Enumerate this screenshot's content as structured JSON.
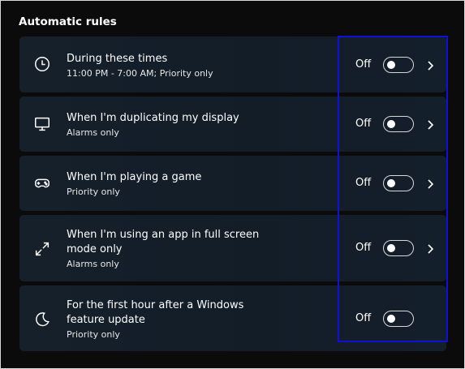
{
  "section": {
    "title": "Automatic rules"
  },
  "rules": [
    {
      "icon": "clock-icon",
      "title": "During these times",
      "subtitle": "11:00 PM - 7:00 AM; Priority only",
      "state": "Off",
      "enabled": false,
      "has_chevron": true
    },
    {
      "icon": "monitor-icon",
      "title": "When I'm duplicating my display",
      "subtitle": "Alarms only",
      "state": "Off",
      "enabled": false,
      "has_chevron": true
    },
    {
      "icon": "gamepad-icon",
      "title": "When I'm playing a game",
      "subtitle": "Priority only",
      "state": "Off",
      "enabled": false,
      "has_chevron": true
    },
    {
      "icon": "fullscreen-icon",
      "title_line1": "When I'm using an app in full screen",
      "title_line2": "mode only",
      "subtitle": "Alarms only",
      "state": "Off",
      "enabled": false,
      "has_chevron": true
    },
    {
      "icon": "moon-icon",
      "title_line1": "For the first hour after a Windows",
      "title_line2": "feature update",
      "subtitle": "Priority only",
      "state": "Off",
      "enabled": false,
      "has_chevron": false
    }
  ],
  "colors": {
    "background": "#0b0b0b",
    "card": "#16202b",
    "highlight": "#1010d8",
    "text": "#ffffff"
  }
}
